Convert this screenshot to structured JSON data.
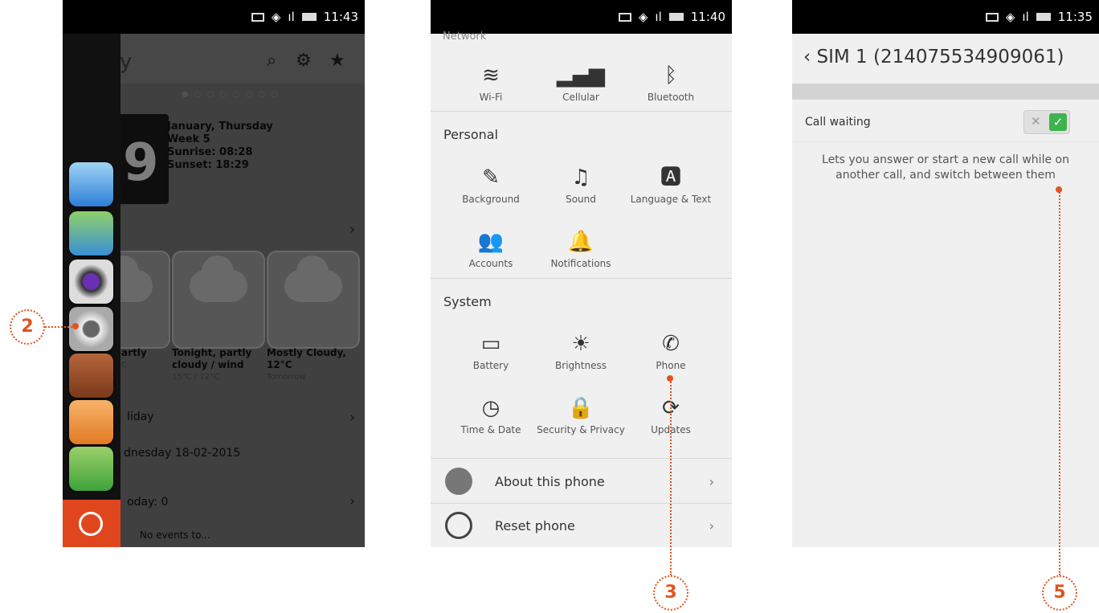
{
  "phone1": {
    "status_time": "11:43",
    "title": "ay",
    "date_lines": [
      "January, Thursday",
      "Week 5",
      "Sunrise: 08:28",
      "Sunset: 18:29"
    ],
    "big_day": "9",
    "weather": [
      {
        "title": "artly",
        "sub": "C"
      },
      {
        "title": "Tonight, partly cloudy / wind",
        "sub": "15°C / 12°C"
      },
      {
        "title": "Mostly Cloudy, 12°C",
        "sub": "Tomorrow"
      }
    ],
    "rows": [
      "liday",
      "dnesday 18-02-2015",
      "oday: 0",
      "No events to..."
    ],
    "launcher_apps": [
      "browser-icon",
      "maps-icon",
      "camera-icon",
      "settings-icon",
      "contacts-icon",
      "messages-icon",
      "phone-icon"
    ]
  },
  "phone2": {
    "status_time": "11:40",
    "network_cut": "Network",
    "network_tiles": [
      "Wi-Fi",
      "Cellular",
      "Bluetooth"
    ],
    "personal_label": "Personal",
    "personal_tiles": [
      "Background",
      "Sound",
      "Language & Text",
      "Accounts",
      "Notifications"
    ],
    "system_label": "System",
    "system_tiles": [
      "Battery",
      "Brightness",
      "Phone",
      "Time & Date",
      "Security & Privacy",
      "Updates"
    ],
    "about": "About this phone",
    "reset": "Reset phone"
  },
  "phone3": {
    "status_time": "11:35",
    "header": "SIM 1 (214075534909061)",
    "call_waiting": "Call waiting",
    "desc_line1": "Lets you answer or start a new call while on",
    "desc_line2": "another call, and switch between them",
    "toggle_on": true
  },
  "callouts": [
    "2",
    "3",
    "5"
  ],
  "colors": {
    "accent": "#e0551f",
    "ubuntu_orange": "#e0461e",
    "toggle_green": "#3eb34f"
  }
}
